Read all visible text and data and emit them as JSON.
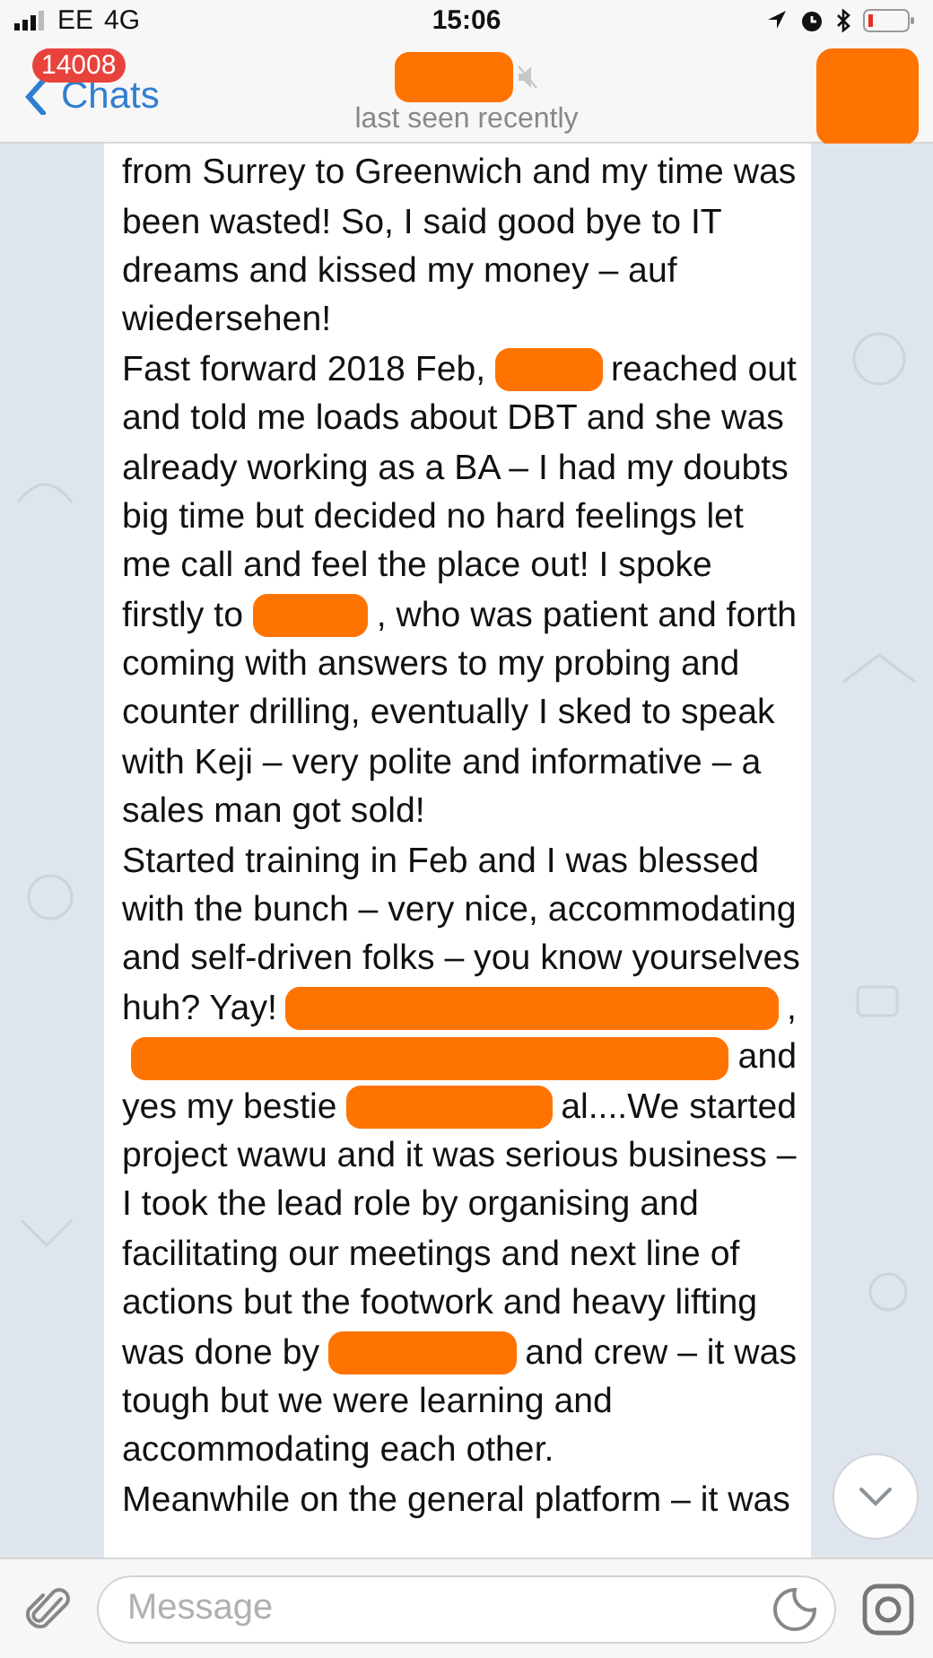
{
  "status_bar": {
    "carrier": "EE",
    "network": "4G",
    "time": "15:06"
  },
  "header": {
    "back_label": "Chats",
    "badge": "14008",
    "title": {
      "kind": "redaction"
    },
    "muted": true,
    "subtitle": "last seen recently",
    "avatar": {
      "kind": "redaction"
    }
  },
  "message": {
    "lines": [
      [
        {
          "kind": "text",
          "text": "from Surrey to Greenwich and my time was"
        }
      ],
      [
        {
          "kind": "text",
          "text": "been wasted! So, I said good bye to IT"
        }
      ],
      [
        {
          "kind": "text",
          "text": "dreams and kissed my money – auf"
        }
      ],
      [
        {
          "kind": "text",
          "text": "wiedersehen!"
        }
      ],
      [
        {
          "kind": "text",
          "text": "Fast forward 2018 Feb,"
        },
        {
          "kind": "redaction"
        },
        {
          "kind": "text",
          "text": "reached out"
        }
      ],
      [
        {
          "kind": "text",
          "text": "and told me loads about DBT and she was"
        }
      ],
      [
        {
          "kind": "text",
          "text": "already working as a BA – I had my doubts"
        }
      ],
      [
        {
          "kind": "text",
          "text": "big time but decided no hard feelings let"
        }
      ],
      [
        {
          "kind": "text",
          "text": "me call and feel the place out! I spoke"
        }
      ],
      [
        {
          "kind": "text",
          "text": "firstly to"
        },
        {
          "kind": "redaction"
        },
        {
          "kind": "text",
          "text": ", who was patient and forth"
        }
      ],
      [
        {
          "kind": "text",
          "text": "coming with answers to my probing and"
        }
      ],
      [
        {
          "kind": "text",
          "text": "counter drilling, eventually I sked to speak"
        }
      ],
      [
        {
          "kind": "text",
          "text": "with Keji – very polite and informative – a"
        }
      ],
      [
        {
          "kind": "text",
          "text": "sales man got sold!"
        }
      ],
      [
        {
          "kind": "text",
          "text": "Started training in Feb and I was blessed"
        }
      ],
      [
        {
          "kind": "text",
          "text": "with the bunch – very nice, accommodating"
        }
      ],
      [
        {
          "kind": "text",
          "text": "and self-driven folks – you know yourselves"
        }
      ],
      [
        {
          "kind": "text",
          "text": "huh? Yay!"
        },
        {
          "kind": "redaction"
        },
        {
          "kind": "text",
          "text": ","
        }
      ],
      [
        {
          "kind": "redaction"
        },
        {
          "kind": "text",
          "text": "and"
        }
      ],
      [
        {
          "kind": "text",
          "text": "yes my bestie"
        },
        {
          "kind": "redaction"
        },
        {
          "kind": "text",
          "text": "al....We started"
        }
      ],
      [
        {
          "kind": "text",
          "text": "project wawu and it was serious business –"
        }
      ],
      [
        {
          "kind": "text",
          "text": "I took the lead role by organising and"
        }
      ],
      [
        {
          "kind": "text",
          "text": "facilitating our meetings and next line of"
        }
      ],
      [
        {
          "kind": "text",
          "text": "actions but the footwork and heavy lifting"
        }
      ],
      [
        {
          "kind": "text",
          "text": "was done by"
        },
        {
          "kind": "redaction"
        },
        {
          "kind": "text",
          "text": "and crew – it was"
        }
      ],
      [
        {
          "kind": "text",
          "text": "tough but we were learning and"
        }
      ],
      [
        {
          "kind": "text",
          "text": "accommodating each other."
        }
      ],
      [
        {
          "kind": "text",
          "text": "Meanwhile on the general platform – it was"
        }
      ]
    ]
  },
  "input": {
    "placeholder": "Message"
  }
}
